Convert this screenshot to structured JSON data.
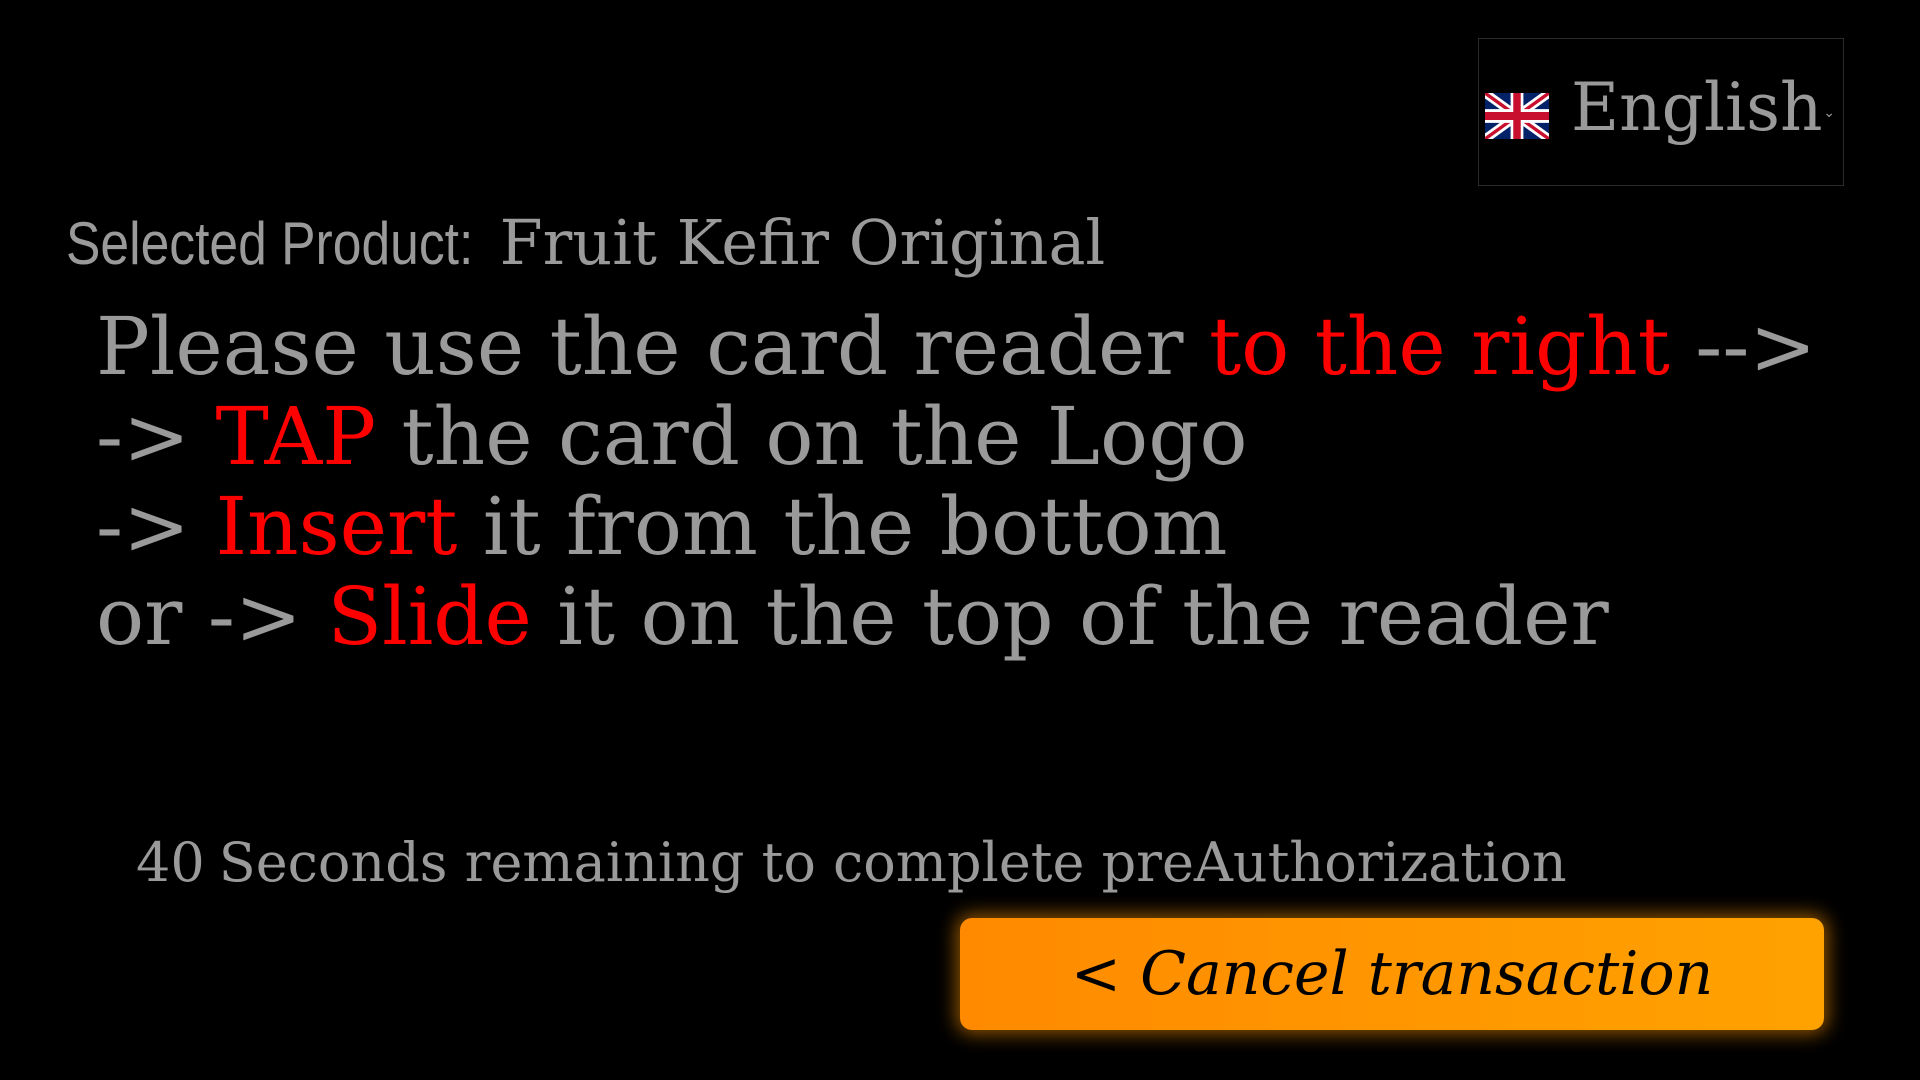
{
  "language_selector": {
    "selected": "English",
    "flag_icon": "uk-flag-icon",
    "caret_icon": "chevron-down-icon"
  },
  "product": {
    "label": "Selected Product:",
    "name": "Fruit Kefir Original"
  },
  "instructions": {
    "line1_prefix": "Please use the card reader ",
    "line1_highlight": "to the right",
    "line1_suffix": " -->",
    "line2_prefix": "-> ",
    "line2_highlight": "TAP",
    "line2_suffix": " the card on the Logo",
    "line3_prefix": "-> ",
    "line3_highlight": "Insert",
    "line3_suffix": " it from the bottom",
    "line4_prefix": "or -> ",
    "line4_highlight": "Slide",
    "line4_suffix": " it on the top of the reader"
  },
  "countdown": {
    "seconds": "40",
    "text": "Seconds remaining to complete preAuthorization"
  },
  "cancel_button": {
    "label": "< Cancel transaction"
  },
  "colors": {
    "background": "#000000",
    "text": "#9a9a9a",
    "highlight": "#ff0000",
    "button": "#ff9800"
  }
}
